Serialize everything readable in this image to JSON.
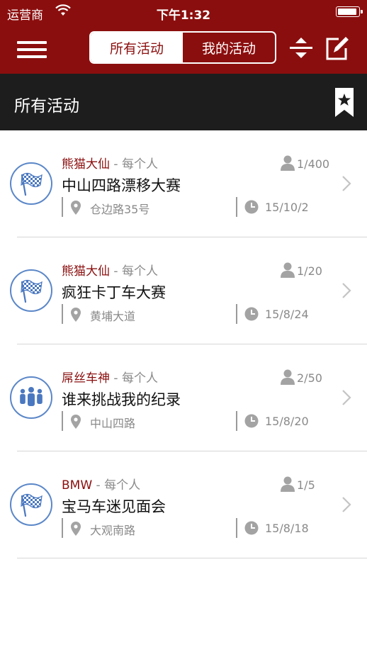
{
  "status_bar": {
    "carrier": "运营商",
    "time": "下午1:32",
    "battery_level": 0.95
  },
  "nav": {
    "tabs": [
      {
        "label": "所有活动",
        "selected": true
      },
      {
        "label": "我的活动",
        "selected": false
      }
    ]
  },
  "section": {
    "title": "所有活动"
  },
  "activities": [
    {
      "organizer": "熊猫大仙",
      "scope": " - 每个人",
      "title": "中山四路漂移大赛",
      "participants": "1/400",
      "location": "仓边路35号",
      "date": "15/10/2",
      "icon": "checkered-flag-icon"
    },
    {
      "organizer": "熊猫大仙",
      "scope": " - 每个人",
      "title": "疯狂卡丁车大赛",
      "participants": "1/20",
      "location": "黄埔大道",
      "date": "15/8/24",
      "icon": "checkered-flag-icon"
    },
    {
      "organizer": "屌丝车神",
      "scope": " - 每个人",
      "title": "谁来挑战我的纪录",
      "participants": "2/50",
      "location": "中山四路",
      "date": "15/8/20",
      "icon": "group-people-icon"
    },
    {
      "organizer": "BMW",
      "scope": " - 每个人",
      "title": "宝马车迷见面会",
      "participants": "1/5",
      "location": "大观南路",
      "date": "15/8/18",
      "icon": "checkered-flag-icon"
    }
  ],
  "colors": {
    "brand": "#8b0e0e",
    "section_bg": "#1d1d1d",
    "icon_blue": "#5b87c8",
    "muted": "#8a8a8a"
  }
}
